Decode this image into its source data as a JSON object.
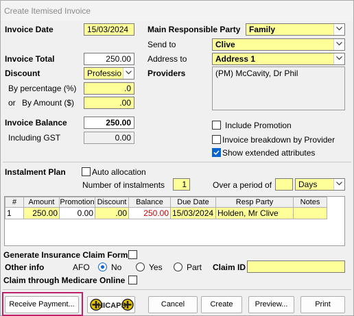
{
  "window": {
    "title": "Create Itemised Invoice"
  },
  "invoice": {
    "date_label": "Invoice Date",
    "date_value": "15/03/2024",
    "total_label": "Invoice Total",
    "total_value": "250.00",
    "discount_label": "Discount",
    "discount_value": "Professio",
    "by_percentage_label": "By percentage (%)",
    "by_percentage_value": ".0",
    "or_label": "or",
    "by_amount_label": "By Amount ($)",
    "by_amount_value": ".00",
    "balance_label": "Invoice Balance",
    "balance_value": "250.00",
    "gst_label": "Including GST",
    "gst_value": "0.00"
  },
  "party": {
    "main_label": "Main Responsible Party",
    "main_value": "Family",
    "send_to_label": "Send to",
    "send_to_value": "Clive",
    "address_label": "Address to",
    "address_value": "Address 1",
    "providers_label": "Providers",
    "providers_value": "(PM) McCavity, Dr Phil"
  },
  "options": {
    "include_promotion": "Include Promotion",
    "breakdown_by_provider": "Invoice breakdown by Provider",
    "show_extended": "Show extended attributes"
  },
  "instalment": {
    "label": "Instalment Plan",
    "auto_allocation": "Auto allocation",
    "number_label": "Number of instalments",
    "number_value": "1",
    "period_label": "Over a period of",
    "period_value": "",
    "period_unit": "Days"
  },
  "table": {
    "headers": [
      "#",
      "Amount",
      "Promotion",
      "Discount",
      "Balance",
      "Due Date",
      "Resp Party",
      "Notes"
    ],
    "rows": [
      {
        "num": "1",
        "amount": "250.00",
        "promotion": "0.00",
        "discount": ".00",
        "balance": "250.00",
        "due_date": "15/03/2024",
        "resp_party": "Holden, Mr Clive",
        "notes": ""
      }
    ]
  },
  "claim": {
    "generate_label": "Generate Insurance Claim Form",
    "other_info_label": "Other info",
    "afo_label": "AFO",
    "no_label": "No",
    "yes_label": "Yes",
    "part_label": "Part",
    "claim_id_label": "Claim ID",
    "claim_id_value": "",
    "medicare_label": "Claim through Medicare Online"
  },
  "buttons": {
    "receive_payment": "Receive  Payment...",
    "hicaps_logo": "HICAPS",
    "cancel": "Cancel",
    "create": "Create",
    "preview": "Preview...",
    "print": "Print"
  },
  "colors": {
    "field_yellow": "#ffff99",
    "highlight_border": "#c0206a",
    "check_blue": "#0a64d0",
    "balance_red": "#d00000"
  }
}
